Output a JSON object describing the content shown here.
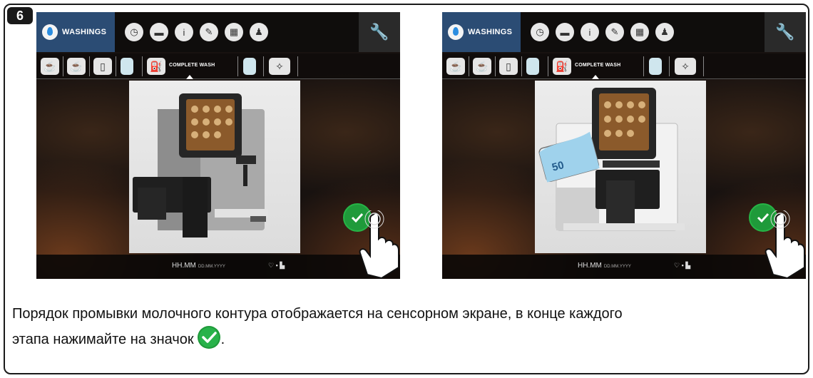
{
  "step_number": "6",
  "screens": [
    {
      "header_tab": "WASHINGS",
      "active_subtab": "COMPLETE WASH",
      "footer_time": "HH.MM",
      "footer_date": "DD.MM.YYYY"
    },
    {
      "header_tab": "WASHINGS",
      "active_subtab": "COMPLETE WASH",
      "footer_time": "HH.MM",
      "footer_date": "DD.MM.YYYY",
      "tablet_label": "50"
    }
  ],
  "caption": {
    "line1": "Порядок промывки молочного контура отображается на сенсорном экране, в конце каждого",
    "line2_before_icon": "этапа нажимайте на значок",
    "line2_after_icon": "."
  },
  "icons": {
    "header": [
      "water-drop-icon",
      "clock-icon",
      "calendar-icon",
      "info-icon",
      "pencil-icon",
      "screen-icon",
      "user-icon",
      "wrench-icon"
    ],
    "subbar": [
      "coffee-cups-icon",
      "coffee-cup-icon",
      "milk-icon",
      "water-glass-icon",
      "complete-wash-icon",
      "glass-icon",
      "sparkle-icon"
    ],
    "confirm": "check-icon"
  },
  "colors": {
    "header_tab_bg": "#2b4c74",
    "check_green": "#1f9a3a"
  }
}
